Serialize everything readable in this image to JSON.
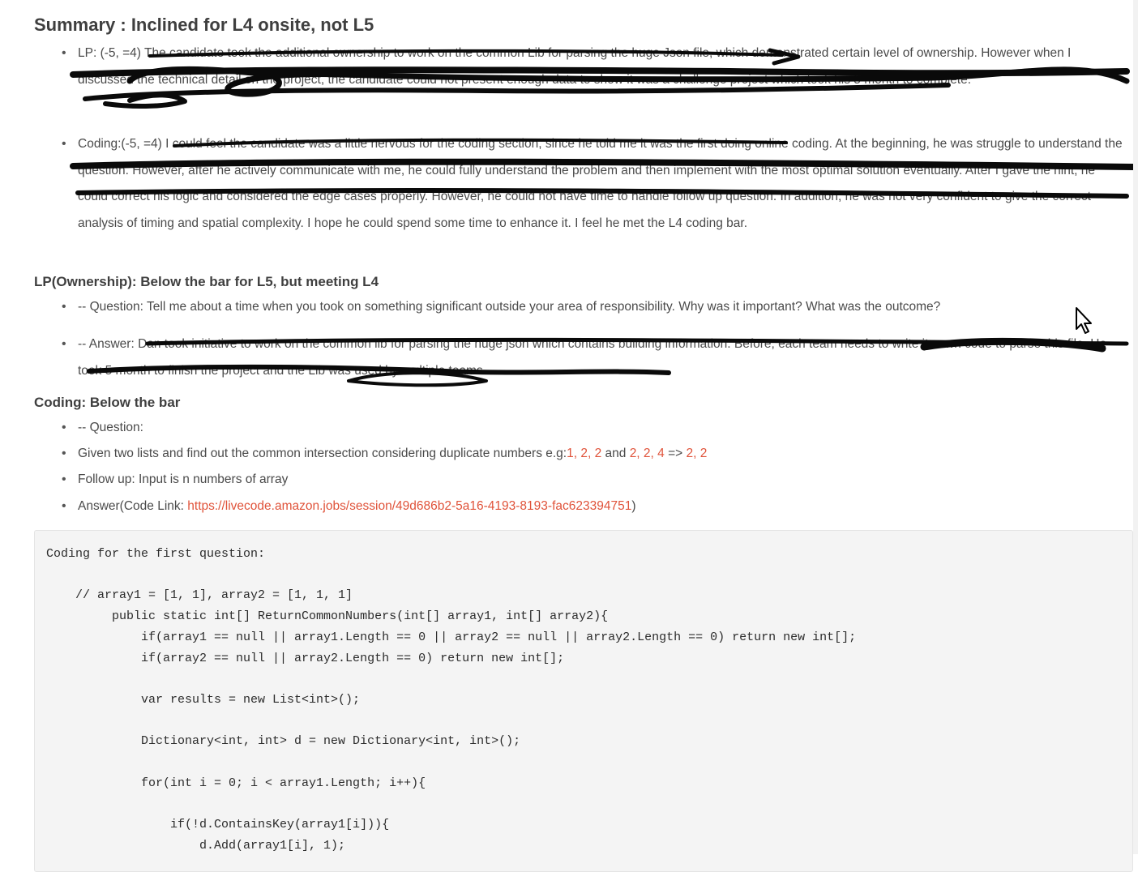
{
  "summary": {
    "title": "Summary : Inclined for L4 onsite, not L5",
    "lp": "LP: (-5, =4) The candidate took the additional ownership to work on the common Lib for parsing the huge Json file, which demonstrated certain level of ownership. However when I discussed the technical detail on the project, the candidate could not present enough data to show it was a challenge project which took his 5 month to complete.",
    "coding": "Coding:(-5, =4) I could feel the candidate was a little nervous for the coding section, since he told me it was the first doing online coding. At the beginning, he was struggle to understand the question. However, after he actively communicate with me, he could fully understand the problem and then implement with the most optimal solution eventually. After I gave the hint, he could correct his logic and considered the edge cases properly. However, he could not have time to handle follow up question. In addition, he was not very confident to give the correct analysis of timing and spatial complexity. I hope he could spend some time to enhance it. I feel he met the L4 coding bar."
  },
  "lp_section": {
    "title": "LP(Ownership): Below the bar for L5, but meeting L4",
    "question": "-- Question: Tell me about a time when you took on something significant outside your area of responsibility. Why was it important? What was the outcome?",
    "answer": "-- Answer: Dan took initiative to work on the common lib for parsing the huge json which contains building information. Before, each team needs to write its own code to parse this file. He took 5 month to finish the project and the Lib was used by multiple teams."
  },
  "coding_section": {
    "title": "Coding: Below the bar",
    "question_label": "-- Question:",
    "question_prefix": "Given two lists and find out the common intersection considering duplicate numbers e.g:",
    "example_a": "1, 2, 2",
    "and_word": " and ",
    "example_b": "2, 2, 4",
    "arrow": " => ",
    "example_result": "2, 2",
    "followup": "Follow up: Input is n numbers of array",
    "answer_prefix": "Answer(Code Link: ",
    "answer_link": "https://livecode.amazon.jobs/session/49d686b2-5a16-4193-8193-fac623394751",
    "answer_suffix": ")"
  },
  "code": {
    "text": "Coding for the first question:\n\n    // array1 = [1, 1], array2 = [1, 1, 1]\n         public static int[] ReturnCommonNumbers(int[] array1, int[] array2){\n             if(array1 == null || array1.Length == 0 || array2 == null || array2.Length == 0) return new int[];\n             if(array2 == null || array2.Length == 0) return new int[];\n\n             var results = new List<int>();\n\n             Dictionary<int, int> d = new Dictionary<int, int>();\n\n             for(int i = 0; i < array1.Length; i++){\n\n                 if(!d.ContainsKey(array1[i])){\n                     d.Add(array1[i], 1);"
  },
  "icons": {
    "bullet": "•",
    "cursor": "mouse-cursor-icon"
  }
}
